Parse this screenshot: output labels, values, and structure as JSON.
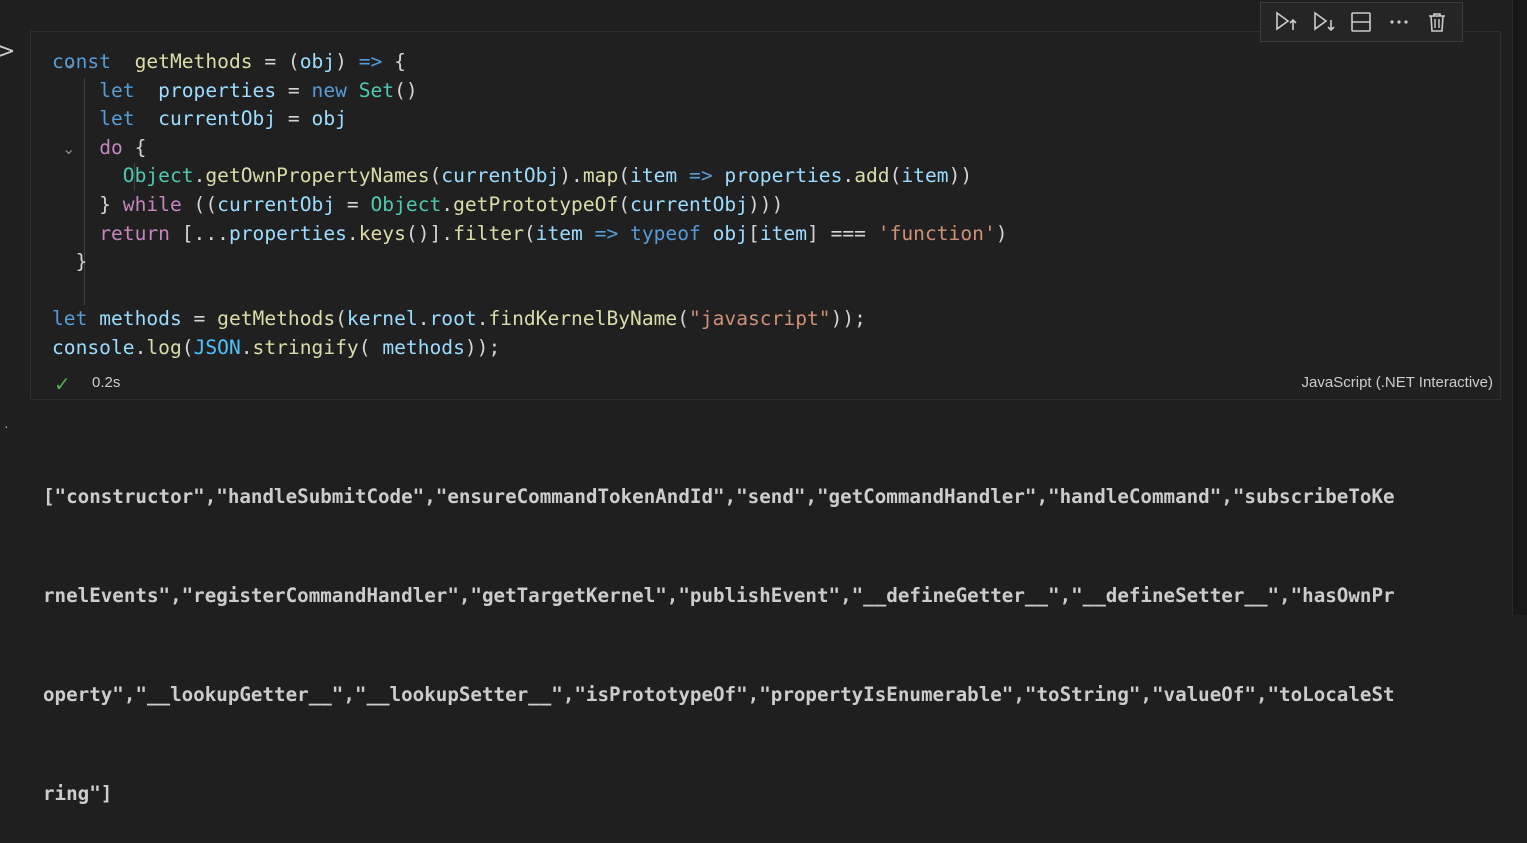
{
  "cell": {
    "status_time": "0.2s",
    "language": "JavaScript (.NET Interactive)",
    "code_lines": [
      [
        [
          "kw",
          "const"
        ],
        [
          "",
          "  "
        ],
        [
          "fn",
          "getMethods"
        ],
        [
          "",
          " = ("
        ],
        [
          "var",
          "obj"
        ],
        [
          "",
          ") "
        ],
        [
          "kw",
          "=>"
        ],
        [
          "",
          " {"
        ]
      ],
      [
        [
          "",
          "    "
        ],
        [
          "kw",
          "let"
        ],
        [
          "",
          ""
        ],
        [
          "",
          ""
        ],
        [
          "",
          "  "
        ],
        [
          "var",
          "properties"
        ],
        [
          "",
          " = "
        ],
        [
          "kw",
          "new"
        ],
        [
          "",
          ""
        ],
        [
          "",
          ""
        ],
        [
          "",
          " "
        ],
        [
          "cls",
          "Set"
        ],
        [
          "",
          "()"
        ]
      ],
      [
        [
          "",
          "    "
        ],
        [
          "kw",
          "let"
        ],
        [
          "",
          "  "
        ],
        [
          "var",
          "currentObj"
        ],
        [
          "",
          " = "
        ],
        [
          "var",
          "obj"
        ]
      ],
      [
        [
          "",
          "    "
        ],
        [
          "ctl",
          "do"
        ],
        [
          "",
          " {"
        ]
      ],
      [
        [
          "",
          "      "
        ],
        [
          "cls",
          "Object"
        ],
        [
          "",
          "."
        ],
        [
          "fn",
          "getOwnPropertyNames"
        ],
        [
          "",
          "("
        ],
        [
          "var",
          "currentObj"
        ],
        [
          "",
          ")."
        ],
        [
          "fn",
          "map"
        ],
        [
          "",
          "("
        ],
        [
          "var",
          "item"
        ],
        [
          "",
          " "
        ],
        [
          "kw",
          "=>"
        ],
        [
          "",
          " "
        ],
        [
          "var",
          "properties"
        ],
        [
          "",
          "."
        ],
        [
          "fn",
          "add"
        ],
        [
          "",
          "("
        ],
        [
          "var",
          "item"
        ],
        [
          "",
          "))"
        ]
      ],
      [
        [
          "",
          "    } "
        ],
        [
          "ctl",
          "while"
        ],
        [
          "",
          " (("
        ],
        [
          "var",
          "currentObj"
        ],
        [
          "",
          " = "
        ],
        [
          "cls",
          "Object"
        ],
        [
          "",
          "."
        ],
        [
          "fn",
          "getPrototypeOf"
        ],
        [
          "",
          "("
        ],
        [
          "var",
          "currentObj"
        ],
        [
          "",
          ")))"
        ]
      ],
      [
        [
          "",
          "    "
        ],
        [
          "ctl",
          "return"
        ],
        [
          "",
          " [..."
        ],
        [
          "var",
          "properties"
        ],
        [
          "",
          "."
        ],
        [
          "fn",
          "keys"
        ],
        [
          "",
          "()]."
        ],
        [
          "fn",
          "filter"
        ],
        [
          "",
          "("
        ],
        [
          "var",
          "item"
        ],
        [
          "",
          " "
        ],
        [
          "kw",
          "=>"
        ],
        [
          "",
          " "
        ],
        [
          "kw",
          "typeof"
        ],
        [
          "",
          " "
        ],
        [
          "var",
          "obj"
        ],
        [
          "",
          "["
        ],
        [
          "var",
          "item"
        ],
        [
          "",
          "] === "
        ],
        [
          "str",
          "'function'"
        ],
        [
          "",
          ")"
        ]
      ],
      [
        [
          "",
          "  }"
        ]
      ],
      [
        [
          "",
          ""
        ]
      ],
      [
        [
          "kw",
          "let"
        ],
        [
          "",
          " "
        ],
        [
          "var",
          "methods"
        ],
        [
          "",
          " = "
        ],
        [
          "fn",
          "getMethods"
        ],
        [
          "",
          "("
        ],
        [
          "var",
          "kernel"
        ],
        [
          "",
          "."
        ],
        [
          "var",
          "root"
        ],
        [
          "",
          "."
        ],
        [
          "fn",
          "findKernelByName"
        ],
        [
          "",
          "("
        ],
        [
          "str",
          "\"javascript\""
        ],
        [
          "",
          "));"
        ]
      ],
      [
        [
          "var",
          "console"
        ],
        [
          "",
          "."
        ],
        [
          "fn",
          "log"
        ],
        [
          "",
          "("
        ],
        [
          "const",
          "JSON"
        ],
        [
          "",
          "."
        ],
        [
          "fn",
          "stringify"
        ],
        [
          "",
          "( "
        ],
        [
          "var",
          "methods"
        ],
        [
          "",
          "));"
        ]
      ]
    ]
  },
  "output": {
    "lines": [
      "[\"constructor\",\"handleSubmitCode\",\"ensureCommandTokenAndId\",\"send\",\"getCommandHandler\",\"handleCommand\",\"subscribeToKe",
      "rnelEvents\",\"registerCommandHandler\",\"getTargetKernel\",\"publishEvent\",\"__defineGetter__\",\"__defineSetter__\",\"hasOwnPr",
      "operty\",\"__lookupGetter__\",\"__lookupSetter__\",\"isPrototypeOf\",\"propertyIsEnumerable\",\"toString\",\"valueOf\",\"toLocaleSt",
      "ring\"]"
    ]
  },
  "toolbar": {
    "buttons": [
      "execute-above-icon",
      "execute-below-icon",
      "split-cell-icon",
      "more-icon",
      "delete-icon"
    ]
  },
  "colors": {
    "keyword": "#569cd6",
    "control": "#c586c0",
    "function": "#dcdcaa",
    "variable": "#9cdcfe",
    "string": "#ce9178",
    "class": "#4ec9b0",
    "success": "#4caf50"
  }
}
